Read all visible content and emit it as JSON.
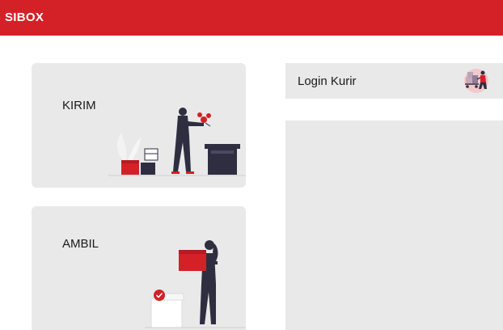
{
  "header": {
    "brand": "SIBOX"
  },
  "cards": {
    "kirim": {
      "label": "KIRIM",
      "illustration_icon": "courier-packing-box-icon"
    },
    "ambil": {
      "label": "AMBIL",
      "illustration_icon": "person-carrying-box-icon"
    }
  },
  "sidebar": {
    "login": {
      "label": "Login Kurir",
      "icon": "courier-trolley-icon"
    }
  },
  "colors": {
    "brand_red": "#d42027",
    "card_bg": "#e9e9e9",
    "dark": "#2f2e41"
  }
}
